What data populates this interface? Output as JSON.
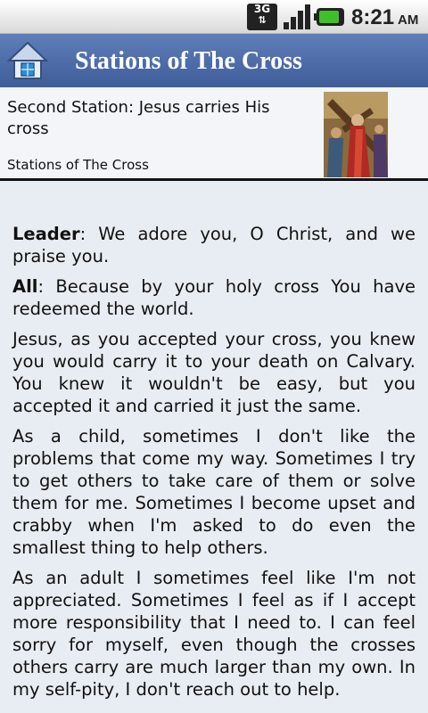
{
  "status_bar": {
    "network_type": "3G",
    "time": "8:21",
    "ampm": "AM",
    "icons": [
      "3g-data-icon",
      "signal-strength-icon",
      "battery-charging-icon"
    ],
    "battery_color": "#3fbf2a"
  },
  "app_bar": {
    "title": "Stations of The Cross",
    "home_icon": "home-icon",
    "background_color": "#4f6faa"
  },
  "header": {
    "station_title": "Second Station: Jesus carries His cross",
    "subtitle": "Stations of The Cross",
    "image_subject": "station-painting"
  },
  "content": {
    "paragraphs": [
      {
        "speaker": "Leader",
        "text": ": We adore you, O Christ, and we praise you."
      },
      {
        "speaker": "All",
        "text": ": Because by your holy cross You have redeemed the world."
      },
      {
        "speaker": "",
        "text": "Jesus, as you accepted your cross, you knew you would carry it to your death on Calvary. You knew it wouldn't be easy, but you accepted it and carried it just the same."
      },
      {
        "speaker": "",
        "text": "As a child, sometimes I don't like the problems that come my way. Sometimes I try to get others to take care of them or solve them for me. Sometimes I become upset and crabby when I'm asked to do even the smallest thing to help others."
      },
      {
        "speaker": "",
        "text": "As an adult I sometimes feel like I'm not appreciated. Sometimes I feel as if I accept more responsibility that I need to. I can feel sorry for myself, even though the crosses others carry are much larger than my own. In my self-pity, I don't reach out to help."
      }
    ]
  }
}
